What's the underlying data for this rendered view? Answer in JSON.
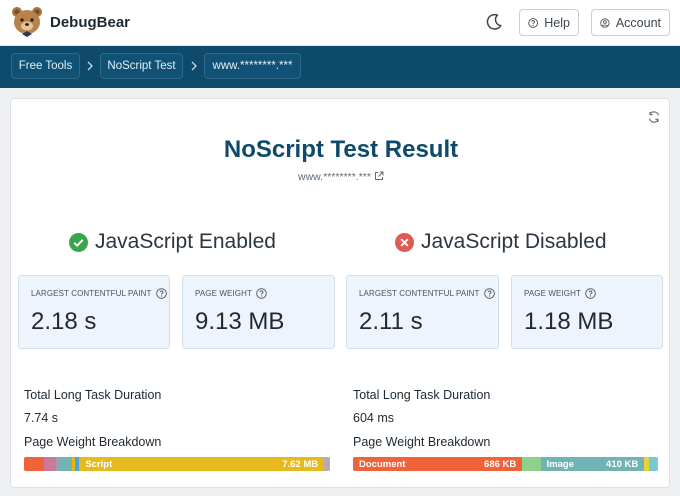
{
  "header": {
    "brand": "DebugBear",
    "help_label": "Help",
    "account_label": "Account",
    "icons": [
      "bear-logo-icon",
      "moon-icon",
      "question-circle-icon",
      "user-circle-icon"
    ]
  },
  "breadcrumb": {
    "items": [
      {
        "label": "Free Tools"
      },
      {
        "label": "NoScript Test"
      },
      {
        "label": "www.********.***"
      }
    ]
  },
  "result": {
    "title": "NoScript Test Result",
    "url": "www.********.***",
    "enabled": {
      "heading": "JavaScript Enabled",
      "status_icon": "check-circle-icon",
      "status_color": "#3aa64c",
      "metrics": [
        {
          "label": "LARGEST CONTENTFUL PAINT",
          "value": "2.18 s"
        },
        {
          "label": "PAGE WEIGHT",
          "value": "9.13 MB"
        }
      ],
      "long_task_label": "Total Long Task Duration",
      "long_task_value": "7.74 s",
      "breakdown_label": "Page Weight Breakdown",
      "breakdown": [
        {
          "color": "#f0623a",
          "share": 0.066,
          "name": "",
          "size": ""
        },
        {
          "color": "#c77a9a",
          "share": 0.04,
          "name": "",
          "size": ""
        },
        {
          "color": "#9aa0a8",
          "share": 0.01,
          "name": "",
          "size": ""
        },
        {
          "color": "#6fb3b5",
          "share": 0.04,
          "name": "",
          "size": ""
        },
        {
          "color": "#f0b400",
          "share": 0.01,
          "name": "",
          "size": ""
        },
        {
          "color": "#4aa4d8",
          "share": 0.015,
          "name": "",
          "size": ""
        },
        {
          "color": "#e6b91e",
          "share": 0.8,
          "name": "Script",
          "size": "7.62 MB"
        },
        {
          "color": "#b9aab6",
          "share": 0.019,
          "name": "",
          "size": ""
        }
      ]
    },
    "disabled": {
      "heading": "JavaScript Disabled",
      "status_icon": "x-circle-icon",
      "status_color": "#e05a54",
      "metrics": [
        {
          "label": "LARGEST CONTENTFUL PAINT",
          "value": "2.11 s"
        },
        {
          "label": "PAGE WEIGHT",
          "value": "1.18 MB"
        }
      ],
      "long_task_label": "Total Long Task Duration",
      "long_task_value": "604 ms",
      "breakdown_label": "Page Weight Breakdown",
      "breakdown": [
        {
          "color": "#f0623a",
          "share": 0.555,
          "name": "Document",
          "size": "686 KB"
        },
        {
          "color": "#8fd18a",
          "share": 0.06,
          "name": "",
          "size": ""
        },
        {
          "color": "#6fb3b5",
          "share": 0.34,
          "name": "Image",
          "size": "410 KB"
        },
        {
          "color": "#e6d33a",
          "share": 0.015,
          "name": "",
          "size": ""
        },
        {
          "color": "#79c9d4",
          "share": 0.03,
          "name": "",
          "size": ""
        }
      ]
    }
  }
}
